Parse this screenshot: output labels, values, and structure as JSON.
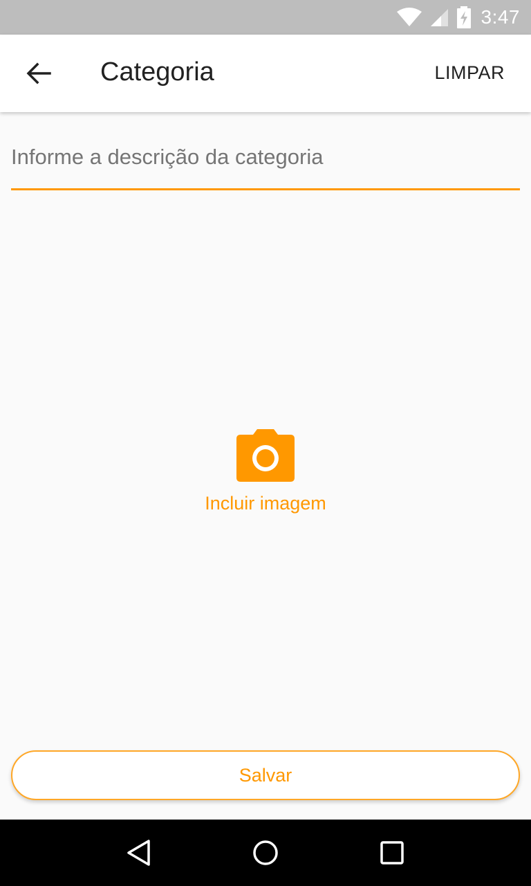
{
  "status_bar": {
    "time": "3:47",
    "icons": [
      "wifi-icon",
      "signal-icon",
      "battery-charging-icon"
    ]
  },
  "app_bar": {
    "back_icon": "arrow-back-icon",
    "title": "Categoria",
    "clear_label": "LIMPAR"
  },
  "form": {
    "description": {
      "value": "",
      "placeholder": "Informe a descrição da categoria"
    },
    "image_picker": {
      "icon": "camera-icon",
      "label": "Incluir imagem"
    },
    "save_label": "Salvar"
  },
  "nav_bar": {
    "buttons": [
      "back-triangle-icon",
      "home-circle-icon",
      "recents-square-icon"
    ]
  },
  "colors": {
    "accent": "#ff9800",
    "status_bar": "#bdbdbd",
    "app_bar": "#ffffff",
    "background": "#fafafa",
    "nav_bar": "#000000"
  }
}
